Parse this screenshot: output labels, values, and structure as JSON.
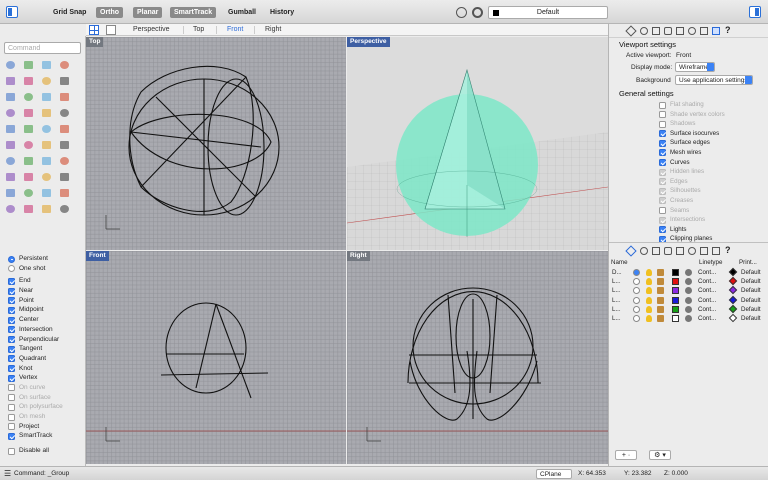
{
  "toolbar": {
    "grid_snap": "Grid Snap",
    "ortho": "Ortho",
    "planar": "Planar",
    "smarttrack": "SmartTrack",
    "gumball": "Gumball",
    "history": "History",
    "layer": "Default"
  },
  "command_placeholder": "Command",
  "viewport_tabs": [
    "Perspective",
    "Top",
    "Front",
    "Right"
  ],
  "active_tab": "Front",
  "viewports": {
    "top": "Top",
    "perspective": "Perspective",
    "front": "Front",
    "right": "Right"
  },
  "osnap": {
    "modes": [
      {
        "label": "Persistent",
        "on": true
      },
      {
        "label": "One shot",
        "on": false
      }
    ],
    "snaps": [
      {
        "label": "End",
        "on": true,
        "enabled": true
      },
      {
        "label": "Near",
        "on": true,
        "enabled": true
      },
      {
        "label": "Point",
        "on": true,
        "enabled": true
      },
      {
        "label": "Midpoint",
        "on": true,
        "enabled": true
      },
      {
        "label": "Center",
        "on": true,
        "enabled": true
      },
      {
        "label": "Intersection",
        "on": true,
        "enabled": true
      },
      {
        "label": "Perpendicular",
        "on": true,
        "enabled": true
      },
      {
        "label": "Tangent",
        "on": true,
        "enabled": true
      },
      {
        "label": "Quadrant",
        "on": true,
        "enabled": true
      },
      {
        "label": "Knot",
        "on": true,
        "enabled": true
      },
      {
        "label": "Vertex",
        "on": true,
        "enabled": true
      },
      {
        "label": "On curve",
        "on": false,
        "enabled": false
      },
      {
        "label": "On surface",
        "on": false,
        "enabled": false
      },
      {
        "label": "On polysurface",
        "on": false,
        "enabled": false
      },
      {
        "label": "On mesh",
        "on": false,
        "enabled": false
      },
      {
        "label": "Project",
        "on": false,
        "enabled": true
      },
      {
        "label": "SmartTrack",
        "on": true,
        "enabled": true
      }
    ],
    "disable_all": "Disable all"
  },
  "viewport_settings": {
    "heading": "Viewport settings",
    "active_label": "Active viewport:",
    "active_value": "Front",
    "display_label": "Display mode:",
    "display_value": "Wireframe",
    "background_label": "Background",
    "background_value": "Use application settings"
  },
  "general_settings": {
    "heading": "General settings",
    "items": [
      {
        "label": "Flat shading",
        "on": false,
        "enabled": false
      },
      {
        "label": "Shade vertex colors",
        "on": false,
        "enabled": false
      },
      {
        "label": "Shadows",
        "on": false,
        "enabled": false
      },
      {
        "label": "Surface isocurves",
        "on": true,
        "enabled": true
      },
      {
        "label": "Surface edges",
        "on": true,
        "enabled": true
      },
      {
        "label": "Mesh wires",
        "on": true,
        "enabled": true
      },
      {
        "label": "Curves",
        "on": true,
        "enabled": true
      },
      {
        "label": "Hidden lines",
        "on": true,
        "enabled": false
      },
      {
        "label": "Edges",
        "on": true,
        "enabled": false
      },
      {
        "label": "Silhouettes",
        "on": true,
        "enabled": false
      },
      {
        "label": "Creases",
        "on": true,
        "enabled": false
      },
      {
        "label": "Seams",
        "on": false,
        "enabled": false
      },
      {
        "label": "Intersections",
        "on": true,
        "enabled": false
      },
      {
        "label": "Lights",
        "on": true,
        "enabled": true
      },
      {
        "label": "Clipping planes",
        "on": true,
        "enabled": true
      }
    ]
  },
  "layers": {
    "headers": {
      "name": "Name",
      "linetype": "Linetype",
      "print": "Print..."
    },
    "rows": [
      {
        "name": "D...",
        "linetype": "Cont...",
        "print": "Default",
        "color": "#000000",
        "print_color": "#000000",
        "current": true
      },
      {
        "name": "L...",
        "linetype": "Cont...",
        "print": "Default",
        "color": "#e01010",
        "print_color": "#e01010",
        "current": false
      },
      {
        "name": "L...",
        "linetype": "Cont...",
        "print": "Default",
        "color": "#8a2be2",
        "print_color": "#8a2be2",
        "current": false
      },
      {
        "name": "L...",
        "linetype": "Cont...",
        "print": "Default",
        "color": "#1a1ad8",
        "print_color": "#1a1ad8",
        "current": false
      },
      {
        "name": "L...",
        "linetype": "Cont...",
        "print": "Default",
        "color": "#17a017",
        "print_color": "#17a017",
        "current": false
      },
      {
        "name": "L...",
        "linetype": "Cont...",
        "print": "Default",
        "color": "#ffffff",
        "print_color": "#ffffff",
        "current": false
      }
    ]
  },
  "status": {
    "command": "Command: _Group",
    "cplane": "CPlane",
    "x": "X: 64.353",
    "y": "Y: 23.382",
    "z": "Z: 0.000"
  },
  "colors": {
    "accent": "#3b82f5",
    "viewport_bg": "#a9aab0",
    "sphere": "#7de8c8"
  }
}
